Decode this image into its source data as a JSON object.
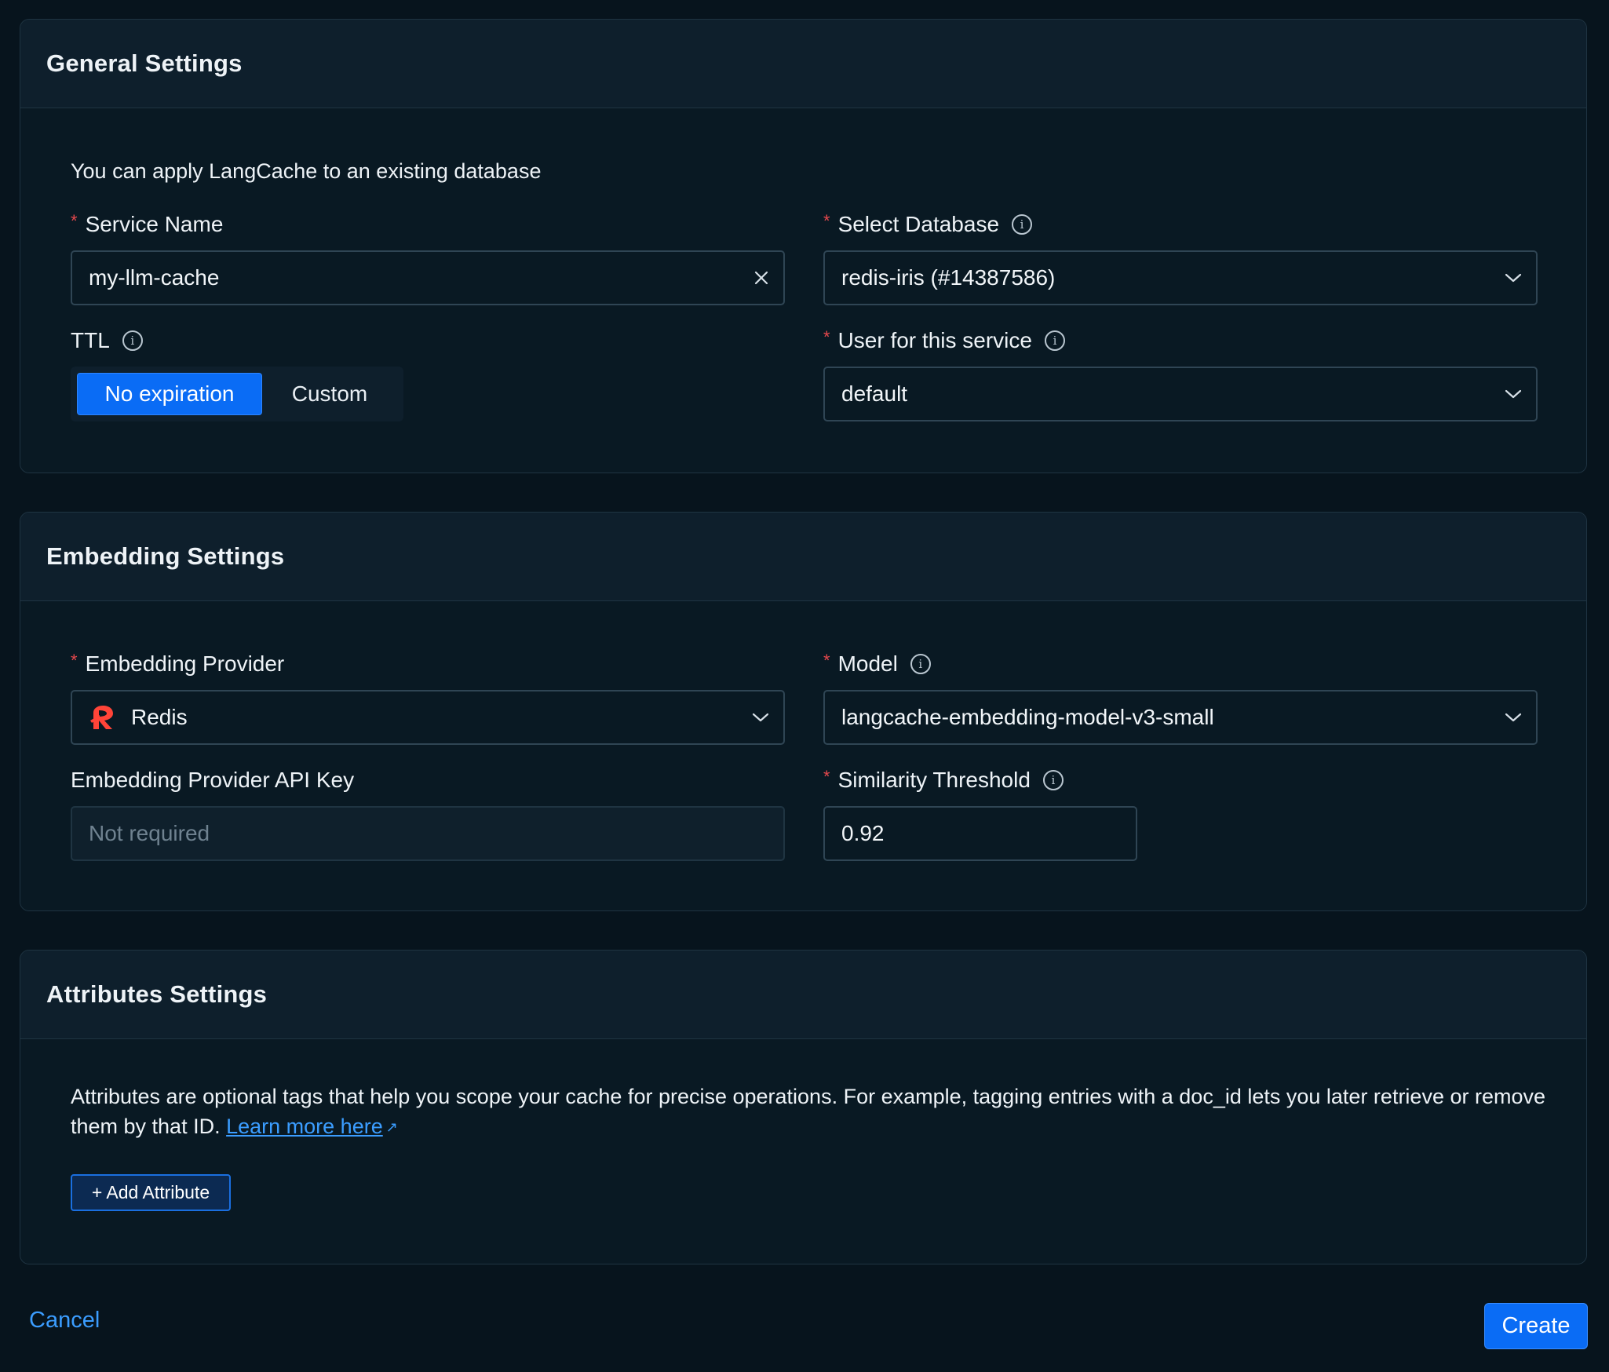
{
  "general": {
    "title": "General Settings",
    "intro": "You can apply LangCache to an existing database",
    "service_name": {
      "label": "Service Name",
      "required": "*",
      "value": "my-llm-cache"
    },
    "select_database": {
      "label": "Select Database",
      "required": "*",
      "value": "redis-iris (#14387586)"
    },
    "ttl": {
      "label": "TTL",
      "options": [
        "No expiration",
        "Custom"
      ],
      "selected": "No expiration"
    },
    "user": {
      "label": "User for this service",
      "required": "*",
      "value": "default"
    }
  },
  "embedding": {
    "title": "Embedding Settings",
    "provider": {
      "label": "Embedding Provider",
      "required": "*",
      "value": "Redis",
      "icon": "redis-logo-icon"
    },
    "model": {
      "label": "Model",
      "required": "*",
      "value": "langcache-embedding-model-v3-small"
    },
    "api_key": {
      "label": "Embedding Provider API Key",
      "placeholder": "Not required"
    },
    "threshold": {
      "label": "Similarity Threshold",
      "required": "*",
      "value": "0.92"
    }
  },
  "attributes": {
    "title": "Attributes Settings",
    "description": "Attributes are optional tags that help you scope your cache for precise operations. For example, tagging entries with a doc_id lets you later retrieve or remove them by that ID.",
    "learn_more": "Learn more here",
    "add_button": "+ Add Attribute"
  },
  "footer": {
    "cancel": "Cancel",
    "create": "Create"
  },
  "colors": {
    "background": "#07141d",
    "panel": "#0c1c28",
    "accent": "#0a6cf5",
    "link": "#3b9dff",
    "required": "#e5484d"
  }
}
